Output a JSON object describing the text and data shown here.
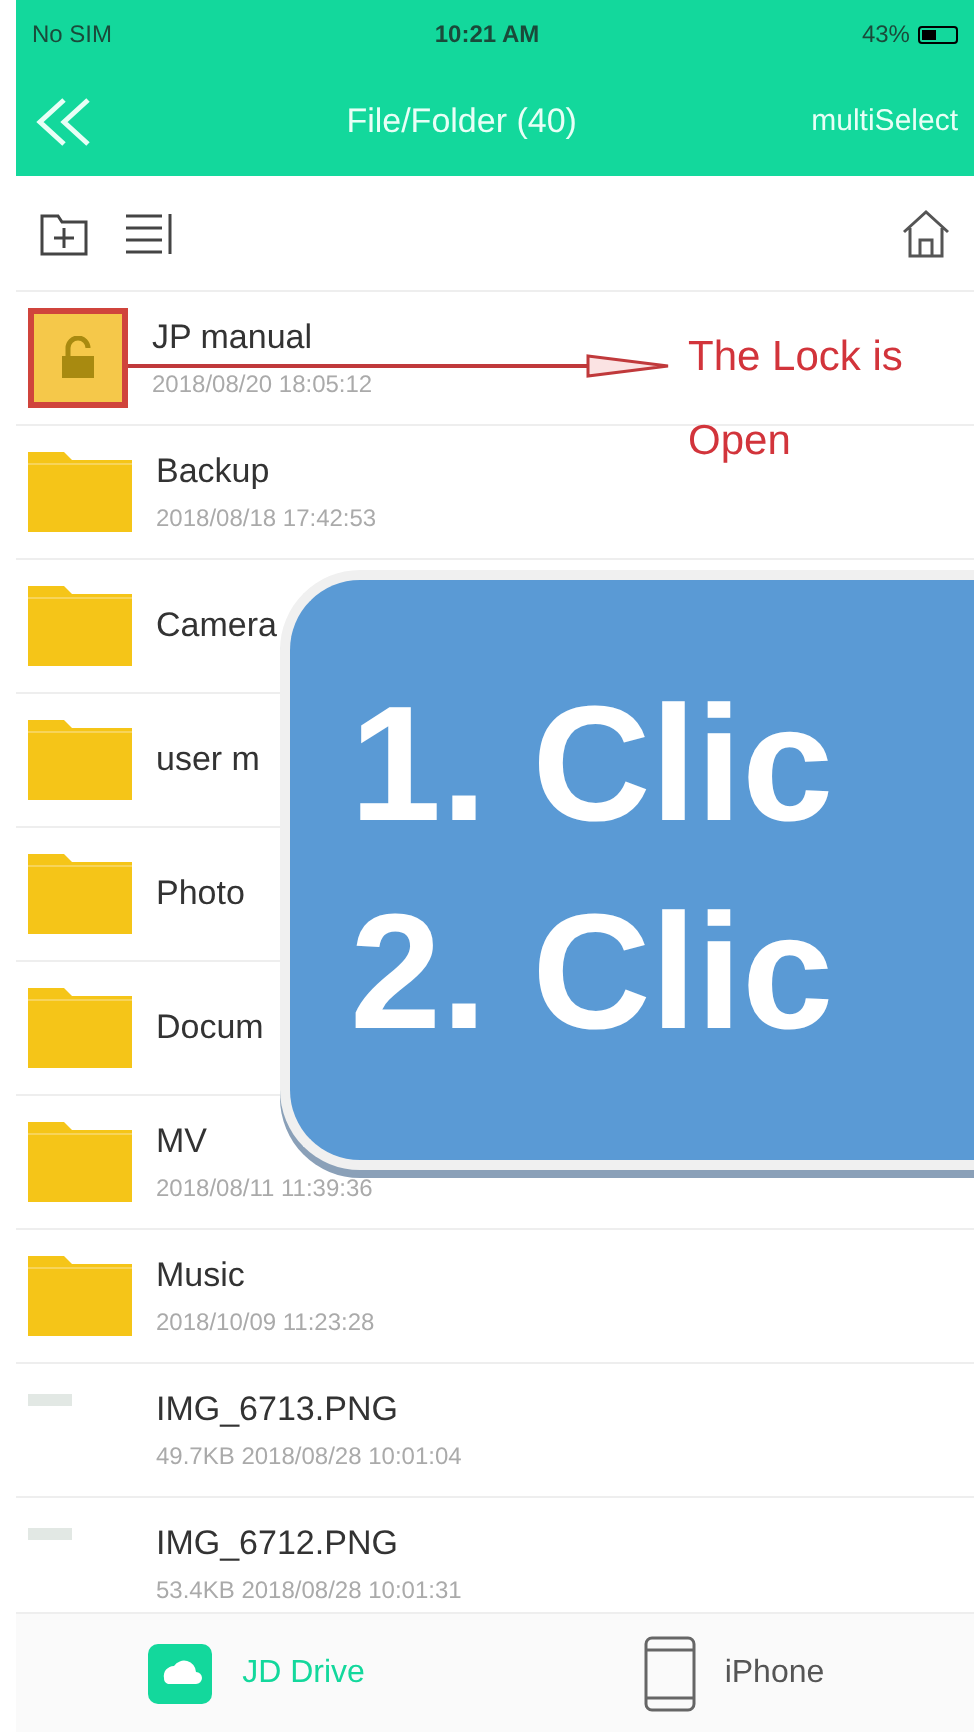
{
  "status_bar": {
    "carrier": "No SIM",
    "time": "10:21 AM",
    "battery": "43%"
  },
  "header": {
    "title": "File/Folder (40)",
    "action": "multiSelect"
  },
  "files": [
    {
      "kind": "locked_folder",
      "name": "JP manual",
      "meta": "2018/08/20 18:05:12"
    },
    {
      "kind": "folder",
      "name": "Backup",
      "meta": "2018/08/18 17:42:53"
    },
    {
      "kind": "folder",
      "name": "Camera"
    },
    {
      "kind": "folder",
      "name": "user m"
    },
    {
      "kind": "folder",
      "name": "Photo"
    },
    {
      "kind": "folder",
      "name": "Docum"
    },
    {
      "kind": "folder",
      "name": "MV",
      "meta": "2018/08/11 11:39:36"
    },
    {
      "kind": "folder",
      "name": "Music",
      "meta": "2018/10/09 11:23:28"
    },
    {
      "kind": "image",
      "name": "IMG_6713.PNG",
      "meta": "49.7KB 2018/08/28 10:01:04"
    },
    {
      "kind": "image",
      "name": "IMG_6712.PNG",
      "meta": "53.4KB 2018/08/28 10:01:31"
    }
  ],
  "annotation": {
    "text": "The Lock is Open"
  },
  "overlay": {
    "lines": [
      "1. Clic",
      "2. Clic"
    ]
  },
  "tabs": [
    {
      "label": "JD Drive",
      "selected": true
    },
    {
      "label": "iPhone",
      "selected": false
    }
  ]
}
